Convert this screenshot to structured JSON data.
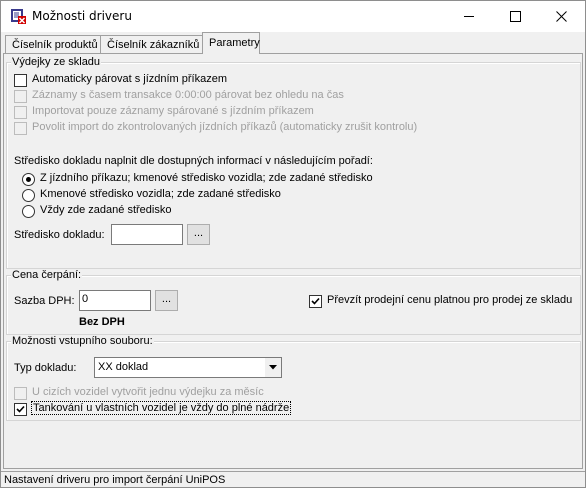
{
  "window": {
    "title": "Možnosti driveru",
    "app_icon": "sk-app-icon",
    "controls": {
      "minimize": "minimize-icon",
      "maximize": "maximize-icon",
      "close": "close-icon"
    }
  },
  "tabs": [
    {
      "label": "Číselník produktů",
      "active": false
    },
    {
      "label": "Číselník zákazníků",
      "active": false
    },
    {
      "label": "Parametry",
      "active": true
    }
  ],
  "vydejky": {
    "group_label": "Výdejky ze skladu",
    "checkboxes": [
      {
        "label": "Automaticky párovat s jízdním příkazem",
        "checked": false,
        "enabled": true
      },
      {
        "label": "Záznamy s časem transakce 0:00:00 párovat bez ohledu na čas",
        "checked": false,
        "enabled": false
      },
      {
        "label": "Importovat pouze záznamy spárované s jízdním příkazem",
        "checked": false,
        "enabled": false
      },
      {
        "label": "Povolit import do zkontrolovaných jízdních příkazů (automaticky zrušit kontrolu)",
        "checked": false,
        "enabled": false
      }
    ],
    "stredisko_heading": "Středisko dokladu naplnit dle dostupných informací v následujícím pořadí:",
    "radios": [
      {
        "label": "Z jízdního příkazu; kmenové středisko vozidla; zde zadané středisko",
        "selected": true
      },
      {
        "label": "Kmenové středisko vozidla; zde zadané středisko",
        "selected": false
      },
      {
        "label": "Vždy zde zadané středisko",
        "selected": false
      }
    ],
    "stredisko_label": "Středisko dokladu:",
    "stredisko_value": "",
    "browse_label": "..."
  },
  "cena": {
    "group_label": "Cena čerpání:",
    "sazba_label": "Sazba DPH:",
    "sazba_value": "0",
    "browse_label": "...",
    "bez_dph": "Bez DPH",
    "prevzit_label": "Převzít prodejní cenu platnou pro prodej ze skladu",
    "prevzit_checked": true
  },
  "moznosti": {
    "group_label": "Možnosti vstupního souboru:",
    "typ_label": "Typ dokladu:",
    "typ_value": "XX doklad",
    "cizich_label": "U cizích vozidel vytvořit jednu výdejku za měsíc",
    "cizich_checked": false,
    "cizich_enabled": false,
    "tankovani_label": "Tankování u vlastních vozidel je vždy do plné nádrže",
    "tankovani_checked": true
  },
  "status": {
    "text": "Nastavení driveru pro import čerpání UniPOS"
  },
  "colors": {
    "window_bg": "#f0f0f0",
    "titlebar_bg": "#ffffff",
    "border": "#a0a0a0",
    "disabled_text": "#a0a0a0"
  }
}
